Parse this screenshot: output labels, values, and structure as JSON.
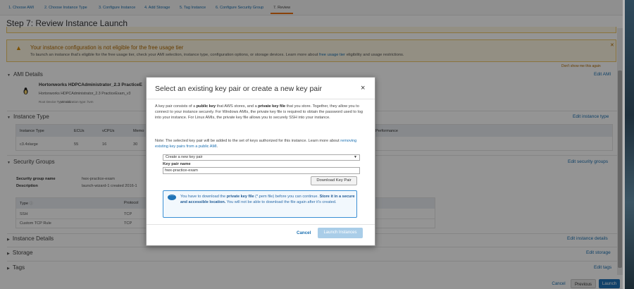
{
  "wizard": {
    "tabs": [
      {
        "label": "1. Choose AMI"
      },
      {
        "label": "2. Choose Instance Type"
      },
      {
        "label": "3. Configure Instance"
      },
      {
        "label": "4. Add Storage"
      },
      {
        "label": "5. Tag Instance"
      },
      {
        "label": "6. Configure Security Group"
      },
      {
        "label": "7. Review"
      }
    ]
  },
  "page": {
    "title": "Step 7: Review Instance Launch"
  },
  "warning": {
    "title": "Your instance configuration is not eligible for the free usage tier",
    "body_prefix": "To launch an instance that's eligible for the free usage tier, check your AMI selection, instance type, configuration options, or storage devices. Learn more about ",
    "body_link": "free usage tier",
    "body_suffix": " eligibility and usage restrictions.",
    "dont_show": "Don't show me this again"
  },
  "ami": {
    "section_title": "AMI Details",
    "edit": "Edit AMI",
    "name": "Hortonworks HDPCAdministrator_2.3 PracticeE",
    "description": "Hortonworks HDPCAdministrator_2.3 PracticeExam_v3",
    "root_device": "Root Device Type: ebs",
    "virtualization": "Virtualization type: hvm"
  },
  "instance_type": {
    "section_title": "Instance Type",
    "edit": "Edit instance type",
    "headers": [
      "Instance Type",
      "ECUs",
      "vCPUs",
      "Memo",
      "Performance"
    ],
    "row": [
      "c3.4xlarge",
      "55",
      "16",
      "30"
    ]
  },
  "security_groups": {
    "section_title": "Security Groups",
    "edit": "Edit security groups",
    "name_label": "Security group name",
    "name_value": "hwx-practice-exam",
    "desc_label": "Description",
    "desc_value": "launch-wizard-1 created 2016-1",
    "rules_headers": [
      "Type",
      "Protocol"
    ],
    "rules": [
      [
        "SSH",
        "TCP"
      ],
      [
        "Custom TCP Rule",
        "TCP"
      ]
    ]
  },
  "instance_details": {
    "section_title": "Instance Details",
    "edit": "Edit instance details"
  },
  "storage": {
    "section_title": "Storage",
    "edit": "Edit storage"
  },
  "tags": {
    "section_title": "Tags",
    "edit": "Edit tags"
  },
  "footer": {
    "cancel": "Cancel",
    "previous": "Previous",
    "launch": "Launch"
  },
  "modal": {
    "title": "Select an existing key pair or create a new key pair",
    "close": "×",
    "p1_a": "A key pair consists of a ",
    "p1_b": "public key",
    "p1_c": " that AWS stores, and a ",
    "p1_d": "private key file",
    "p1_e": " that you store. Together, they allow you to connect to your instance securely. For Windows AMIs, the private key file is required to obtain the password used to log into your instance. For Linux AMIs, the private key file allows you to securely SSH into your instance.",
    "p2_a": "Note: The selected key pair will be added to the set of keys authorized for this instance. Learn more about ",
    "p2_link": "removing existing key pairs from a public AMI",
    "p2_c": ".",
    "select_value": "Create a new key pair",
    "key_pair_label": "Key pair name",
    "key_pair_value": "hwx-practice-exam",
    "download_button": "Download Key Pair",
    "info_a": "You have to download the ",
    "info_b": "private key file",
    "info_c": " (*.pem file) before you can continue. ",
    "info_d": "Store it in a secure and accessible location.",
    "info_e": " You will not be able to download the file again after it's created.",
    "cancel": "Cancel",
    "launch": "Launch Instances"
  },
  "colors": {
    "accent": "#1f73b7",
    "link": "#1a6fb0",
    "warning_bg": "#fdf6e2",
    "tab_active": "#ec7211"
  }
}
